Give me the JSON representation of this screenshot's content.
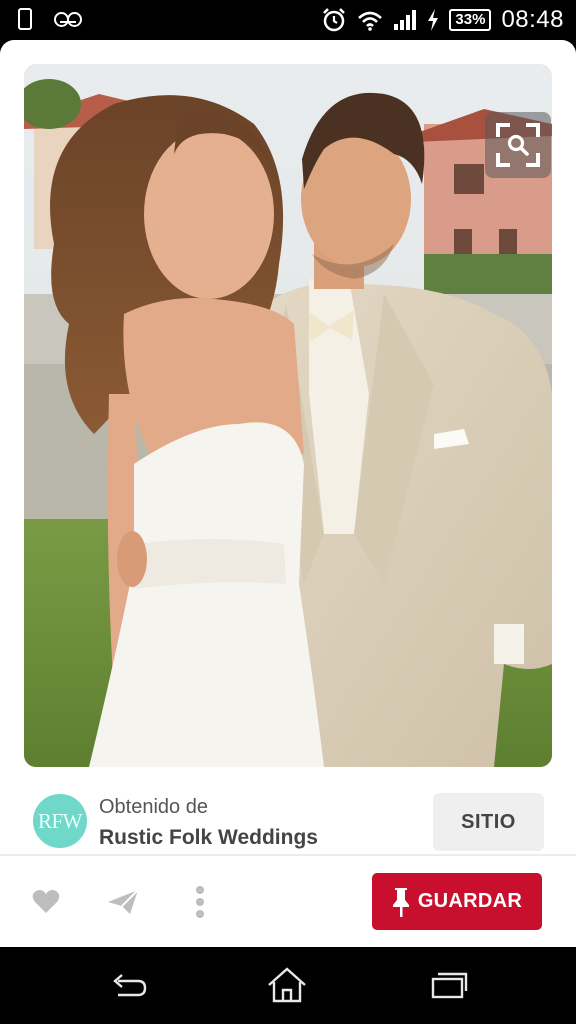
{
  "status_bar": {
    "battery": "33%",
    "time": "08:48",
    "icons": [
      "phone-icon",
      "voicemail-icon",
      "alarm-icon",
      "wifi-icon",
      "signal-icon",
      "charging-icon",
      "battery-icon"
    ]
  },
  "pin": {
    "image": "photo-icon",
    "lens_icon": "visual-search-icon"
  },
  "source": {
    "avatar_text": "RFW",
    "label": "Obtenido de",
    "name": "Rustic Folk Weddings",
    "site_button": "SITIO"
  },
  "actions": {
    "icons": [
      "heart-icon",
      "send-icon",
      "more-vertical-icon"
    ],
    "save_button": "GUARDAR",
    "save_icon": "pushpin-icon"
  },
  "nav_bar": {
    "icons": [
      "back-icon",
      "home-icon",
      "recent-apps-icon"
    ]
  },
  "colors": {
    "accent": "#c8102e",
    "avatar": "#6fd8c8"
  }
}
